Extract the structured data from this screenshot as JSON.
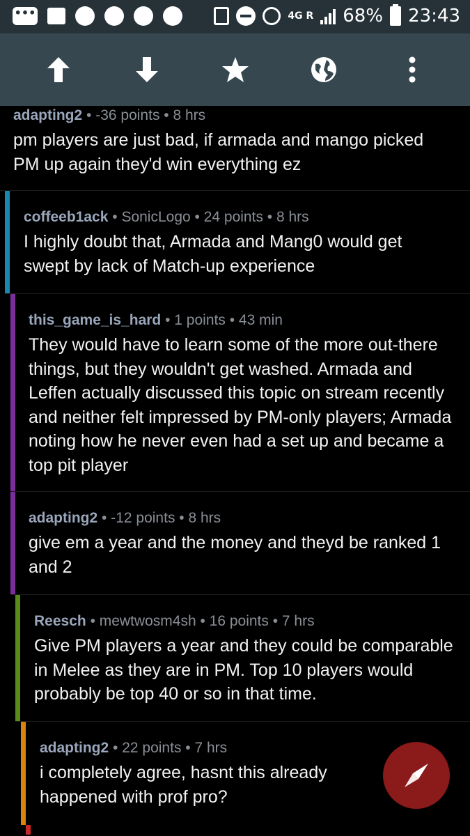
{
  "status_bar": {
    "network": "4G R",
    "battery": "68%",
    "time": "23:43"
  },
  "toolbar": {
    "icons": [
      "arrow-up-icon",
      "arrow-down-icon",
      "star-icon",
      "globe-icon",
      "more-vert-icon"
    ]
  },
  "colors": {
    "background": "#000000",
    "toolbar": "#37474f",
    "statusbar": "#263238",
    "depth1": "#1a87b3",
    "depth2": "#7b2d9b",
    "depth3": "#5a8a1a",
    "depth4": "#d9820f",
    "depth5": "#c62828",
    "fab": "#8b1a1a"
  },
  "comments": [
    {
      "author": "adapting2",
      "flair": "",
      "points": "-36 points",
      "time": "8 hrs",
      "text": "pm players are just bad, if armada and mango picked PM up again they'd win everything ez"
    },
    {
      "author": "coffeeb1ack",
      "flair": "SonicLogo",
      "points": "24 points",
      "time": "8 hrs",
      "text": "I highly doubt that, Armada and Mang0 would get swept by lack of Match-up experience"
    },
    {
      "author": "this_game_is_hard",
      "flair": "",
      "points": "1 points",
      "time": "43 min",
      "text": "They would have to learn some of the more out-there things, but they wouldn't get washed. Armada and Leffen actually discussed this topic on stream recently and neither felt impressed by PM-only players; Armada noting how he never even had a set up and became a top pit player"
    },
    {
      "author": "adapting2",
      "flair": "",
      "points": "-12 points",
      "time": "8 hrs",
      "text": "give em a year and the money and theyd be ranked 1 and 2"
    },
    {
      "author": "Reesch",
      "flair": "mewtwosm4sh",
      "points": "16 points",
      "time": "7 hrs",
      "text": "Give PM players a year and they could be comparable in Melee as they are in PM. Top 10 players would probably be top 40 or so in that time."
    },
    {
      "author": "adapting2",
      "flair": "",
      "points": "22 points",
      "time": "7 hrs",
      "text": "i completely agree, hasnt this already happened with prof pro?"
    }
  ],
  "fab": {
    "icon": "compass-icon"
  }
}
